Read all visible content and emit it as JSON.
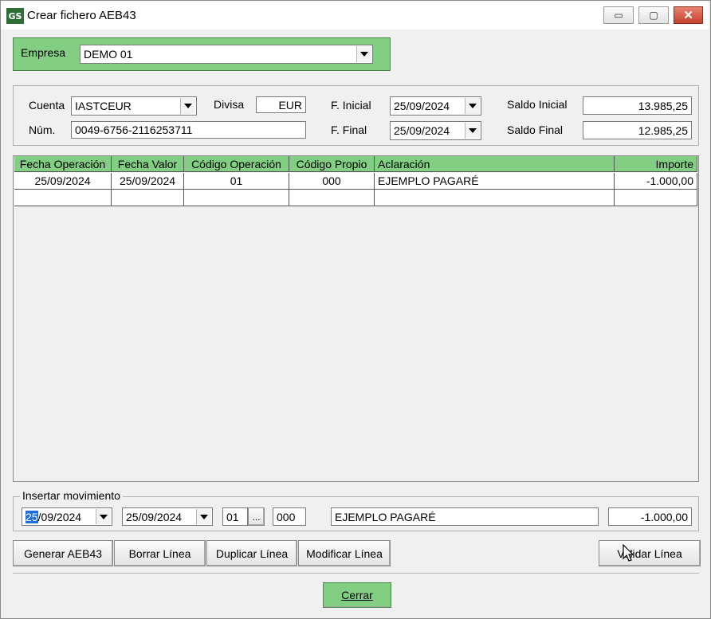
{
  "window": {
    "title": "Crear fichero AEB43",
    "app_icon": "GS"
  },
  "titlebar_buttons": {
    "minimize": "▭",
    "maximize": "▢",
    "close": "✕"
  },
  "empresa": {
    "label": "Empresa",
    "value": "DEMO 01"
  },
  "account": {
    "cuenta_label": "Cuenta",
    "cuenta_value": "IASTCEUR",
    "divisa_label": "Divisa",
    "divisa_value": "EUR",
    "f_inicial_label": "F. Inicial",
    "f_inicial_value": "25/09/2024",
    "saldo_inicial_label": "Saldo Inicial",
    "saldo_inicial_value": "13.985,25",
    "num_label": "Núm.",
    "num_value": "0049-6756-2116253711",
    "f_final_label": "F. Final",
    "f_final_value": "25/09/2024",
    "saldo_final_label": "Saldo Final",
    "saldo_final_value": "12.985,25"
  },
  "table": {
    "headers": [
      "Fecha Operación",
      "Fecha Valor",
      "Código Operación",
      "Código Propio",
      "Aclaración",
      "Importe"
    ],
    "rows": [
      [
        "25/09/2024",
        "25/09/2024",
        "01",
        "000",
        "EJEMPLO PAGARÉ",
        "-1.000,00"
      ]
    ]
  },
  "insert": {
    "legend": "Insertar movimiento",
    "fecha_op_highlight": "25",
    "fecha_op_rest": "/09/2024",
    "fecha_valor": "25/09/2024",
    "codigo_op": "01",
    "lookup_label": "...",
    "codigo_propio": "000",
    "aclaracion": "EJEMPLO PAGARÉ",
    "importe": "-1.000,00"
  },
  "buttons": {
    "generar": "Generar AEB43",
    "borrar": "Borrar Línea",
    "duplicar": "Duplicar Línea",
    "modificar": "Modificar Línea",
    "validar": "Validar Línea",
    "cerrar": "Cerrar"
  }
}
